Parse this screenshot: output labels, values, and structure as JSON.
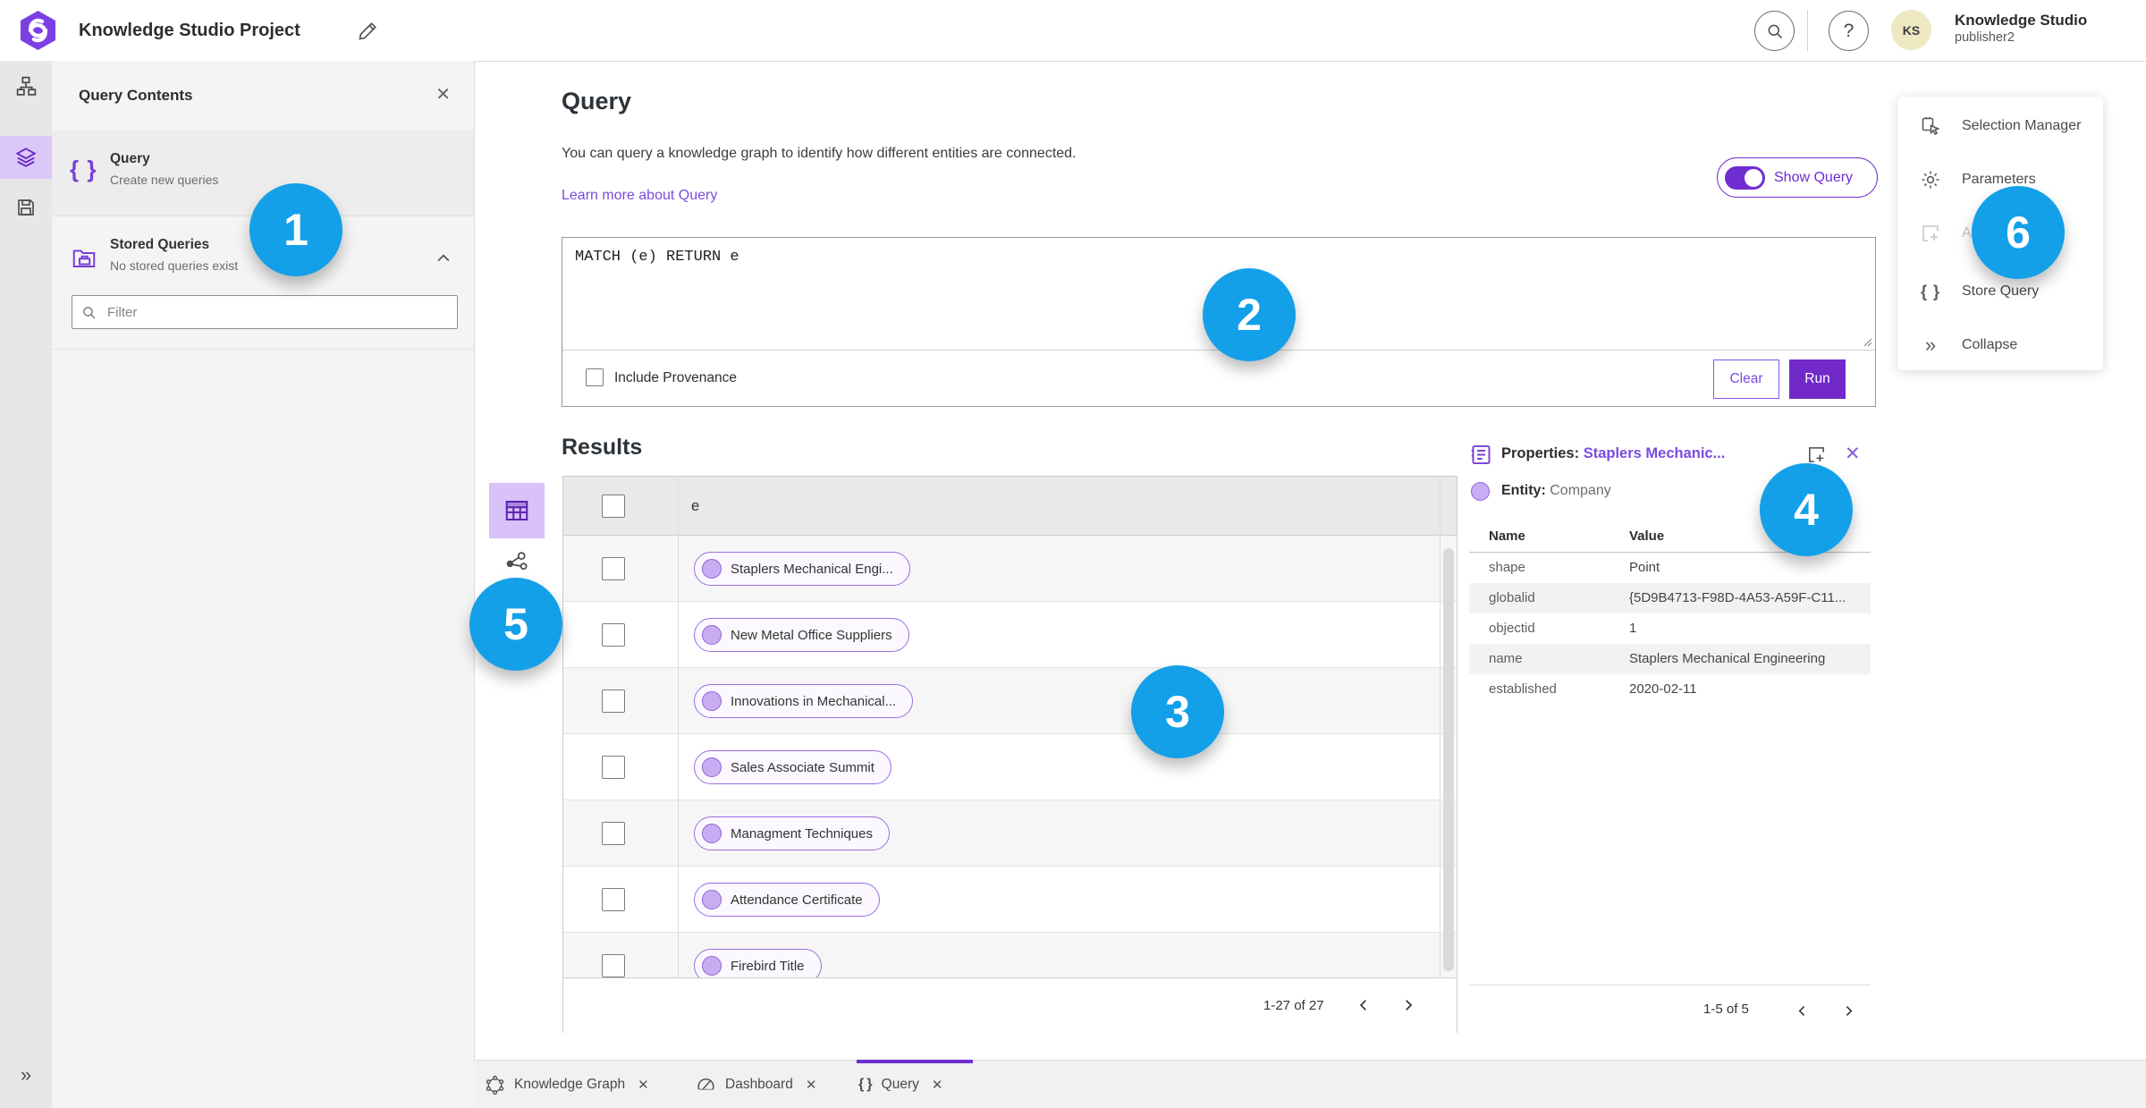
{
  "topbar": {
    "title": "Knowledge Studio Project",
    "user_name": "Knowledge Studio",
    "user_role": "publisher2",
    "avatar_initials": "KS",
    "help_glyph": "?"
  },
  "left_panel": {
    "title": "Query Contents",
    "close_glyph": "✕",
    "items": [
      {
        "label": "Query",
        "sublabel": "Create new queries",
        "icon": "braces-icon"
      },
      {
        "label": "Stored Queries",
        "sublabel": "No stored queries exist",
        "icon": "stored-queries-folder-icon"
      }
    ],
    "filter_placeholder": "Filter"
  },
  "query_section": {
    "title": "Query",
    "description": "You can query a knowledge graph to identify how different entities are connected.",
    "link": "Learn more about Query",
    "show_query_label": "Show Query",
    "query_text": "MATCH (e) RETURN e",
    "include_provenance_label": "Include Provenance",
    "clear_label": "Clear",
    "run_label": "Run"
  },
  "results": {
    "title": "Results",
    "column_header": "e",
    "rows": [
      "Staplers Mechanical Engi...",
      "New Metal Office Suppliers",
      "Innovations in Mechanical...",
      "Sales Associate Summit",
      "Managment Techniques",
      "Attendance Certificate",
      "Firebird Title"
    ],
    "pagination": "1-27 of 27"
  },
  "properties_panel": {
    "title_label": "Properties:",
    "title_value": "Staplers Mechanic...",
    "entity_label": "Entity:",
    "entity_value": "Company",
    "columns": {
      "name": "Name",
      "value": "Value"
    },
    "rows": [
      {
        "name": "shape",
        "value": "Point"
      },
      {
        "name": "globalid",
        "value": "{5D9B4713-F98D-4A53-A59F-C11..."
      },
      {
        "name": "objectid",
        "value": "1"
      },
      {
        "name": "name",
        "value": "Staplers Mechanical Engineering"
      },
      {
        "name": "established",
        "value": "2020-02-11"
      }
    ],
    "pagination": "1-5 of 5"
  },
  "context_menu": {
    "items": [
      {
        "label": "Selection Manager",
        "icon": "selection-manager-icon",
        "disabled": false
      },
      {
        "label": "Parameters",
        "icon": "gear-icon",
        "disabled": false
      },
      {
        "label": "Add To Map",
        "icon": "add-to-map-icon",
        "disabled": true
      },
      {
        "label": "Store Query",
        "icon": "braces-icon",
        "disabled": false
      },
      {
        "label": "Collapse",
        "icon": "collapse-icon",
        "disabled": false
      }
    ],
    "braces_glyph": "{ }",
    "collapse_glyph": "»"
  },
  "bottom_tabs": [
    {
      "label": "Knowledge Graph",
      "icon": "knowledge-graph-icon",
      "active": false,
      "close_glyph": "✕"
    },
    {
      "label": "Dashboard",
      "icon": "dashboard-icon",
      "active": false,
      "close_glyph": "✕"
    },
    {
      "label": "Query",
      "icon": "braces-icon",
      "active": true,
      "close_glyph": "✕"
    }
  ],
  "callouts": [
    "1",
    "2",
    "3",
    "4",
    "5",
    "6"
  ],
  "colors": {
    "accent_purple": "#6f2dd1",
    "run_button_purple": "#7129c9",
    "link_purple": "#7a4be0",
    "rail_selected_bg": "#dcc8f8",
    "pill_border": "#9a6fe0",
    "pill_dot_fill": "#c9adf2",
    "callout_blue": "#14a0e9",
    "avatar_bg": "#eee9c3"
  }
}
